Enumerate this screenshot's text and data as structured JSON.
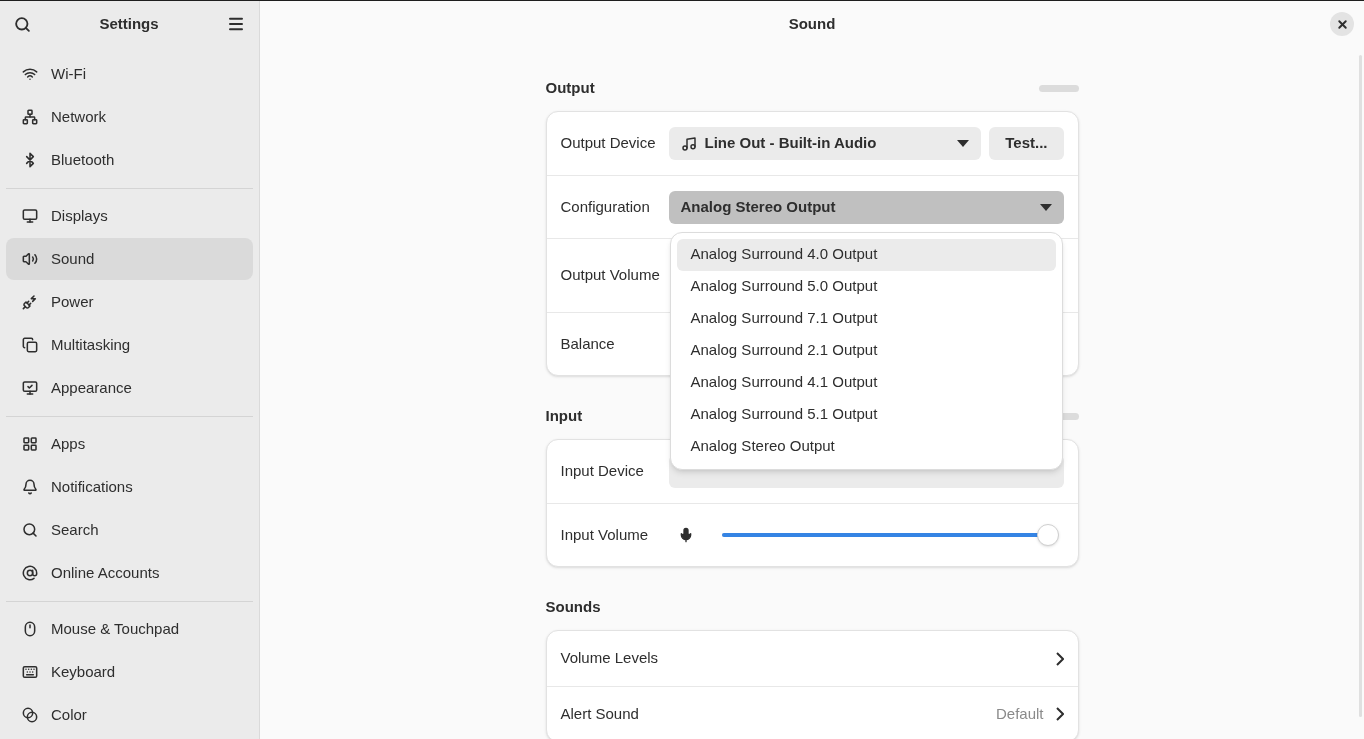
{
  "sidebar": {
    "title": "Settings",
    "groups": [
      [
        {
          "label": "Wi-Fi",
          "selected": false
        },
        {
          "label": "Network",
          "selected": false
        },
        {
          "label": "Bluetooth",
          "selected": false
        }
      ],
      [
        {
          "label": "Displays",
          "selected": false
        },
        {
          "label": "Sound",
          "selected": true
        },
        {
          "label": "Power",
          "selected": false
        },
        {
          "label": "Multitasking",
          "selected": false
        },
        {
          "label": "Appearance",
          "selected": false
        }
      ],
      [
        {
          "label": "Apps",
          "selected": false
        },
        {
          "label": "Notifications",
          "selected": false
        },
        {
          "label": "Search",
          "selected": false
        },
        {
          "label": "Online Accounts",
          "selected": false
        }
      ],
      [
        {
          "label": "Mouse & Touchpad",
          "selected": false
        },
        {
          "label": "Keyboard",
          "selected": false
        },
        {
          "label": "Color",
          "selected": false
        }
      ]
    ]
  },
  "page_title": "Sound",
  "sections": [
    {
      "heading": "Output",
      "rows": [
        {
          "kind": "combo",
          "label": "Output Device",
          "value": "Line Out - Built-in Audio",
          "button": "Test...",
          "pressed": false
        },
        {
          "kind": "combo",
          "label": "Configuration",
          "value": "Analog Stereo Output",
          "pressed": true
        },
        {
          "kind": "plain",
          "label": "Output Volume"
        },
        {
          "kind": "plain",
          "label": "Balance"
        }
      ]
    },
    {
      "heading": "Input",
      "rows": [
        {
          "kind": "combo",
          "label": "Input Device",
          "pressed": false
        },
        {
          "kind": "slider",
          "label": "Input Volume",
          "level": 0.97
        }
      ]
    },
    {
      "heading": "Sounds",
      "rows": [
        {
          "kind": "link",
          "label": "Volume Levels"
        },
        {
          "kind": "link",
          "label": "Alert Sound",
          "value": "Default"
        }
      ]
    }
  ],
  "popup": {
    "items": [
      {
        "label": "Analog Surround 4.0 Output",
        "highlighted": true
      },
      {
        "label": "Analog Surround 5.0 Output",
        "highlighted": false
      },
      {
        "label": "Analog Surround 7.1 Output",
        "highlighted": false
      },
      {
        "label": "Analog Surround 2.1 Output",
        "highlighted": false
      },
      {
        "label": "Analog Surround 4.1 Output",
        "highlighted": false
      },
      {
        "label": "Analog Surround 5.1 Output",
        "highlighted": false
      },
      {
        "label": "Analog Stereo Output",
        "highlighted": false
      }
    ]
  }
}
